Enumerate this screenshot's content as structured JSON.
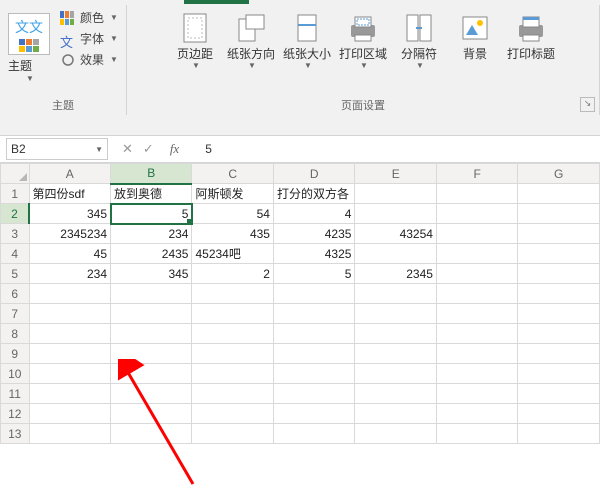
{
  "ribbon": {
    "theme": {
      "label": "主题",
      "colors_label": "颜色",
      "fonts_label": "字体",
      "effects_label": "效果",
      "group_label": "主题"
    },
    "page_setup": {
      "margins": "页边距",
      "orientation": "纸张方向",
      "size": "纸张大小",
      "print_area": "打印区域",
      "breaks": "分隔符",
      "background": "背景",
      "print_titles": "打印标题",
      "group_label": "页面设置"
    }
  },
  "namebox": {
    "value": "B2"
  },
  "formula": {
    "value": "5"
  },
  "grid": {
    "columns": [
      "A",
      "B",
      "C",
      "D",
      "E",
      "F",
      "G"
    ],
    "active": {
      "col": "B",
      "row": 2
    },
    "rows": [
      {
        "n": 1,
        "cells": [
          "第四份sdf",
          "放到奥德",
          "阿斯顿发",
          "打分的双方各",
          "",
          "",
          ""
        ],
        "text_row": true
      },
      {
        "n": 2,
        "cells": [
          "345",
          "5",
          "54",
          "4",
          "",
          "",
          ""
        ]
      },
      {
        "n": 3,
        "cells": [
          "2345234",
          "234",
          "435",
          "4235",
          "43254",
          "",
          ""
        ]
      },
      {
        "n": 4,
        "cells": [
          "45",
          "2435",
          "45234吧",
          "4325",
          "",
          "",
          ""
        ]
      },
      {
        "n": 5,
        "cells": [
          "234",
          "345",
          "2",
          "5",
          "2345",
          "",
          ""
        ]
      },
      {
        "n": 6,
        "cells": [
          "",
          "",
          "",
          "",
          "",
          "",
          ""
        ]
      },
      {
        "n": 7,
        "cells": [
          "",
          "",
          "",
          "",
          "",
          "",
          ""
        ]
      },
      {
        "n": 8,
        "cells": [
          "",
          "",
          "",
          "",
          "",
          "",
          ""
        ]
      },
      {
        "n": 9,
        "cells": [
          "",
          "",
          "",
          "",
          "",
          "",
          ""
        ]
      },
      {
        "n": 10,
        "cells": [
          "",
          "",
          "",
          "",
          "",
          "",
          ""
        ]
      },
      {
        "n": 11,
        "cells": [
          "",
          "",
          "",
          "",
          "",
          "",
          ""
        ]
      },
      {
        "n": 12,
        "cells": [
          "",
          "",
          "",
          "",
          "",
          "",
          ""
        ]
      },
      {
        "n": 13,
        "cells": [
          "",
          "",
          "",
          "",
          "",
          "",
          ""
        ]
      }
    ]
  }
}
